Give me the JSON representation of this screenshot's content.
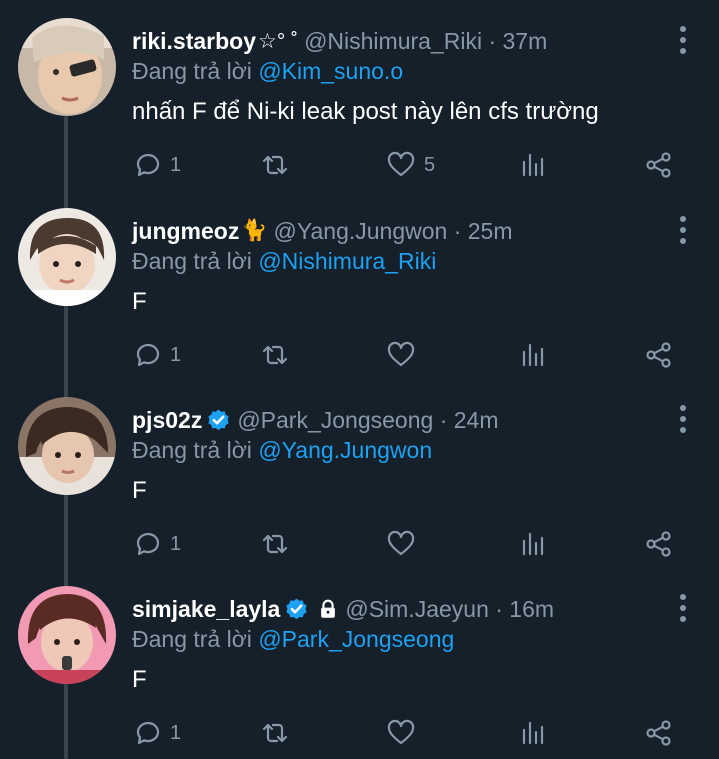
{
  "reply_prefix": "Đang trả lời",
  "colors": {
    "background": "#15202b",
    "text": "#ffffff",
    "muted": "#8899a6",
    "accent": "#1da1f2"
  },
  "tweets": [
    {
      "display_name": "riki.starboy",
      "name_decoration": "☆° ˚",
      "handle": "@Nishimura_Riki · 37m",
      "reply_to": "@Kim_suno.o",
      "text": "nhấn F để Ni-ki leak post này lên cfs trường",
      "reply_count": "1",
      "like_count": "5",
      "verified": false,
      "locked": false
    },
    {
      "display_name": "jungmeoz",
      "name_decoration": "🐈",
      "handle": "@Yang.Jungwon · 25m",
      "reply_to": "@Nishimura_Riki",
      "text": "F",
      "reply_count": "1",
      "like_count": "",
      "verified": false,
      "locked": false
    },
    {
      "display_name": "pjs02z",
      "name_decoration": "",
      "handle": "@Park_Jongseong · 24m",
      "reply_to": "@Yang.Jungwon",
      "text": "F",
      "reply_count": "1",
      "like_count": "",
      "verified": true,
      "locked": false
    },
    {
      "display_name": "simjake_layla",
      "name_decoration": "",
      "handle": "@Sim.Jaeyun · 16m",
      "reply_to": "@Park_Jongseong",
      "text": "F",
      "reply_count": "1",
      "like_count": "",
      "verified": true,
      "locked": true
    }
  ],
  "icons": {
    "reply": "reply-icon",
    "retweet": "retweet-icon",
    "like": "heart-icon",
    "stats": "stats-icon",
    "share": "share-icon",
    "more": "more-icon",
    "verified": "verified-badge-icon",
    "locked": "lock-icon"
  }
}
